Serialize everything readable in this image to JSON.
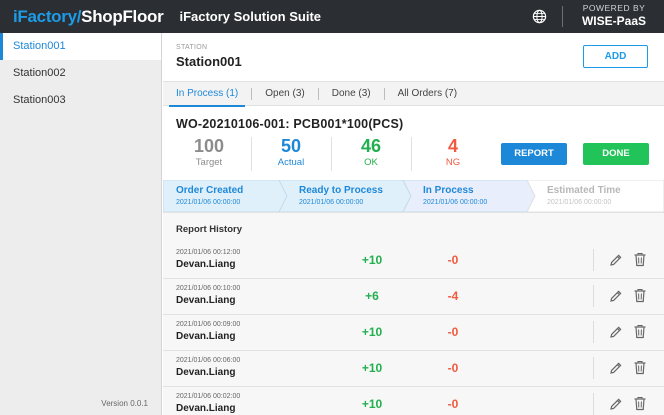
{
  "topbar": {
    "brand_part1": "iFactory/",
    "brand_part2": "ShopFloor",
    "suite_title": "iFactory Solution Suite",
    "powered_line1": "POWERED BY",
    "powered_line2": "WISE-PaaS",
    "globe_icon": "globe-icon"
  },
  "sidebar": {
    "items": [
      {
        "label": "Station001",
        "active": true
      },
      {
        "label": "Station002",
        "active": false
      },
      {
        "label": "Station003",
        "active": false
      }
    ],
    "version": "Version 0.0.1"
  },
  "station": {
    "caption": "STATION",
    "name": "Station001",
    "add_label": "ADD"
  },
  "tabs": [
    {
      "label": "In Process (1)",
      "active": true
    },
    {
      "label": "Open (3)",
      "active": false
    },
    {
      "label": "Done (3)",
      "active": false
    },
    {
      "label": "All Orders (7)",
      "active": false
    }
  ],
  "order": {
    "title": "WO-20210106-001: PCB001*100(PCS)",
    "stats": [
      {
        "value": "100",
        "label": "Target",
        "color": "#8c8c8c"
      },
      {
        "value": "50",
        "label": "Actual",
        "color": "#1e88d8"
      },
      {
        "value": "46",
        "label": "OK",
        "color": "#22b04f"
      },
      {
        "value": "4",
        "label": "NG",
        "color": "#f05a3e"
      }
    ],
    "report_label": "REPORT",
    "done_label": "DONE"
  },
  "progress": [
    {
      "title": "Order Created",
      "date": "2021/01/06 00:00:00",
      "state": "done"
    },
    {
      "title": "Ready to Process",
      "date": "2021/01/06 00:00:00",
      "state": "done"
    },
    {
      "title": "In Process",
      "date": "2021/01/06 00:00:00",
      "state": "current"
    },
    {
      "title": "Estimated Time",
      "date": "2021/01/06 00:00:00",
      "state": "future"
    }
  ],
  "history": {
    "title": "Report History",
    "rows": [
      {
        "time": "2021/01/06 00:12:00",
        "user": "Devan.Liang",
        "ok": "+10",
        "ng": "-0"
      },
      {
        "time": "2021/01/06 00:10:00",
        "user": "Devan.Liang",
        "ok": "+6",
        "ng": "-4"
      },
      {
        "time": "2021/01/06 00:09:00",
        "user": "Devan.Liang",
        "ok": "+10",
        "ng": "-0"
      },
      {
        "time": "2021/01/06 00:06:00",
        "user": "Devan.Liang",
        "ok": "+10",
        "ng": "-0"
      },
      {
        "time": "2021/01/06 00:02:00",
        "user": "Devan.Liang",
        "ok": "+10",
        "ng": "-0"
      }
    ]
  },
  "colors": {
    "accent": "#1e88d8",
    "ok": "#22b04f",
    "ng": "#f05a3e",
    "done_button": "#22c45a",
    "topbar": "#2b2f33"
  }
}
